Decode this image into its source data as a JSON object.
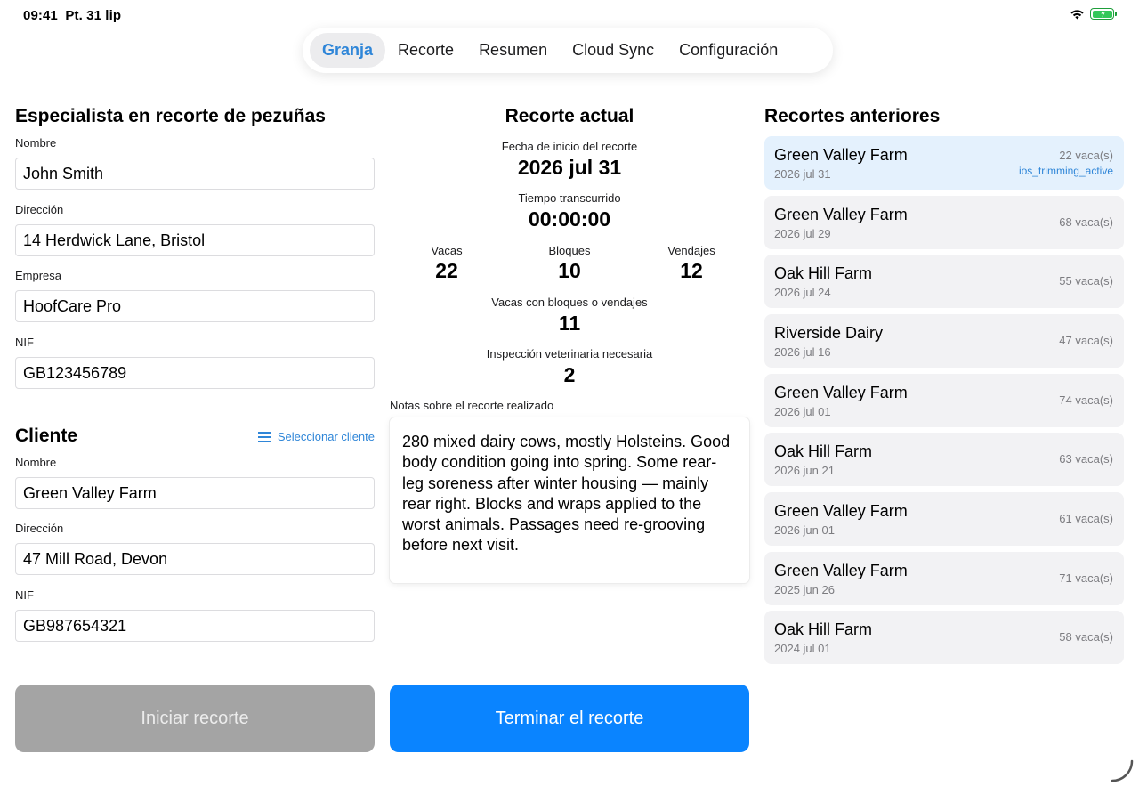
{
  "status": {
    "time": "09:41",
    "date": "Pt. 31 lip"
  },
  "tabs": [
    "Granja",
    "Recorte",
    "Resumen",
    "Cloud Sync",
    "Configuración"
  ],
  "trimmer": {
    "title": "Especialista en recorte de pezuñas",
    "name_label": "Nombre",
    "name": "John Smith",
    "address_label": "Dirección",
    "address": "14 Herdwick Lane, Bristol",
    "company_label": "Empresa",
    "company": "HoofCare Pro",
    "nif_label": "NIF",
    "nif": "GB123456789"
  },
  "client": {
    "title": "Cliente",
    "select_label": "Seleccionar cliente",
    "name_label": "Nombre",
    "name": "Green Valley Farm",
    "address_label": "Dirección",
    "address": "47 Mill Road, Devon",
    "nif_label": "NIF",
    "nif": "GB987654321"
  },
  "current": {
    "title": "Recorte actual",
    "start_label": "Fecha de inicio del recorte",
    "start": "2026 jul 31",
    "elapsed_label": "Tiempo transcurrido",
    "elapsed": "00:00:00",
    "cows_label": "Vacas",
    "cows": "22",
    "blocks_label": "Bloques",
    "blocks": "10",
    "wraps_label": "Vendajes",
    "wraps": "12",
    "cows_bw_label": "Vacas con bloques o vendajes",
    "cows_bw": "11",
    "vet_label": "Inspección veterinaria necesaria",
    "vet": "2",
    "notes_label": "Notas sobre el recorte realizado",
    "notes": "280 mixed dairy cows, mostly Holsteins. Good body condition going into spring. Some rear-leg soreness after winter housing — mainly rear right. Blocks and wraps applied to the worst animals. Passages need re-grooving before next visit."
  },
  "buttons": {
    "start": "Iniciar recorte",
    "end": "Terminar el recorte"
  },
  "previous": {
    "title": "Recortes anteriores",
    "items": [
      {
        "farm": "Green Valley Farm",
        "date": "2026 jul 31",
        "count": "22 vaca(s)",
        "status": "ios_trimming_active"
      },
      {
        "farm": "Green Valley Farm",
        "date": "2026 jul 29",
        "count": "68 vaca(s)"
      },
      {
        "farm": "Oak Hill Farm",
        "date": "2026 jul 24",
        "count": "55 vaca(s)"
      },
      {
        "farm": "Riverside Dairy",
        "date": "2026 jul 16",
        "count": "47 vaca(s)"
      },
      {
        "farm": "Green Valley Farm",
        "date": "2026 jul 01",
        "count": "74 vaca(s)"
      },
      {
        "farm": "Oak Hill Farm",
        "date": "2026 jun 21",
        "count": "63 vaca(s)"
      },
      {
        "farm": "Green Valley Farm",
        "date": "2026 jun 01",
        "count": "61 vaca(s)"
      },
      {
        "farm": "Green Valley Farm",
        "date": "2025 jun 26",
        "count": "71 vaca(s)"
      },
      {
        "farm": "Oak Hill Farm",
        "date": "2024 jul 01",
        "count": "58 vaca(s)"
      }
    ]
  },
  "colors": {
    "accent": "#0a84ff",
    "tab_active": "#2f86d8",
    "disabled": "#a4a4a4"
  }
}
